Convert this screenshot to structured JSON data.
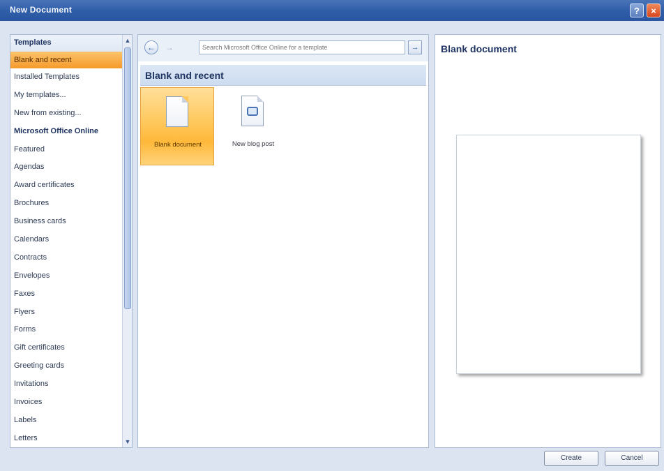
{
  "window": {
    "title": "New Document",
    "help_icon": "?",
    "close_icon": "×"
  },
  "nav": {
    "items": [
      {
        "label": "Templates",
        "kind": "header"
      },
      {
        "label": "Blank and recent",
        "kind": "selected"
      },
      {
        "label": "Installed Templates"
      },
      {
        "label": "My templates..."
      },
      {
        "label": "New from existing..."
      },
      {
        "label": "Microsoft Office Online",
        "kind": "header"
      },
      {
        "label": "Featured"
      },
      {
        "label": "Agendas"
      },
      {
        "label": "Award certificates"
      },
      {
        "label": "Brochures"
      },
      {
        "label": "Business cards"
      },
      {
        "label": "Calendars"
      },
      {
        "label": "Contracts"
      },
      {
        "label": "Envelopes"
      },
      {
        "label": "Faxes"
      },
      {
        "label": "Flyers"
      },
      {
        "label": "Forms"
      },
      {
        "label": "Gift certificates"
      },
      {
        "label": "Greeting cards"
      },
      {
        "label": "Invitations"
      },
      {
        "label": "Invoices"
      },
      {
        "label": "Labels"
      },
      {
        "label": "Letters"
      }
    ],
    "scroll_up": "▲",
    "scroll_down": "▼"
  },
  "middle": {
    "back_icon": "←",
    "forward_icon": "→",
    "search": {
      "placeholder": "Search Microsoft Office Online for a template",
      "go_icon": "→"
    },
    "section_title": "Blank and recent",
    "tiles": [
      {
        "label": "Blank document",
        "icon": "blank-document-icon",
        "selected": true
      },
      {
        "label": "New blog post",
        "icon": "blog-post-icon",
        "selected": false
      }
    ]
  },
  "preview": {
    "title": "Blank document"
  },
  "buttons": {
    "create": "Create",
    "cancel": "Cancel"
  },
  "colors": {
    "titlebar": "#2f5ea8",
    "selection": "#f5a030",
    "pane_border": "#a7b9d3"
  }
}
